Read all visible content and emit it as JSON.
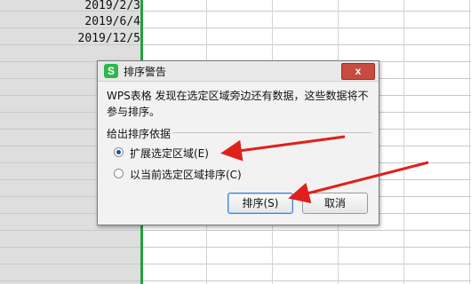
{
  "sheet": {
    "dates": [
      "2019/2/3",
      "2019/6/4",
      "2019/12/5"
    ]
  },
  "dialog": {
    "app_logo_letter": "S",
    "title": "排序警告",
    "close_glyph": "x",
    "message": "WPS表格 发现在选定区域旁边还有数据，这些数据将不参与排序。",
    "group_label": "给出排序依据",
    "options": [
      {
        "label": "扩展选定区域(E)",
        "checked": true
      },
      {
        "label": "以当前选定区域排序(C)",
        "checked": false
      }
    ],
    "sort_button": "排序(S)",
    "cancel_button": "取消"
  },
  "annotations": {
    "arrow_color": "#e0201b"
  }
}
